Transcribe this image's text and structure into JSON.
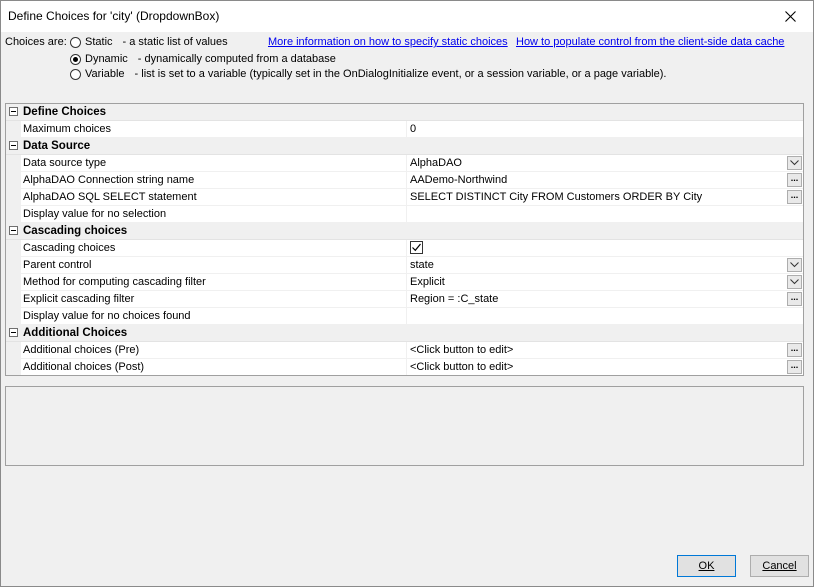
{
  "window": {
    "title": "Define Choices for 'city' (DropdownBox)"
  },
  "choices": {
    "label": "Choices are:",
    "options": [
      {
        "label": "Static",
        "desc": "- a static list of values",
        "checked": false
      },
      {
        "label": "Dynamic",
        "desc": "- dynamically computed from a database",
        "checked": true
      },
      {
        "label": "Variable",
        "desc": "- list is set to a variable (typically set in the OnDialogInitialize event, or a session variable, or a page variable).",
        "checked": false
      }
    ],
    "link_static": "More information on how to specify static choices",
    "link_cache": "How to populate control from the client-side data cache"
  },
  "grid": {
    "sections": [
      {
        "label": "Define Choices",
        "rows": [
          {
            "name": "Maximum choices",
            "value": "0"
          }
        ]
      },
      {
        "label": "Data Source",
        "rows": [
          {
            "name": "Data source type",
            "value": "AlphaDAO"
          },
          {
            "name": "AlphaDAO Connection string name",
            "value": "AADemo-Northwind"
          },
          {
            "name": "AlphaDAO SQL SELECT statement",
            "value": "SELECT DISTINCT City FROM Customers ORDER BY City"
          },
          {
            "name": "Display value for no selection",
            "value": ""
          }
        ]
      },
      {
        "label": "Cascading choices",
        "rows": [
          {
            "name": "Cascading choices",
            "value": "",
            "checked": true
          },
          {
            "name": "Parent control",
            "value": "state"
          },
          {
            "name": "Method for computing cascading filter",
            "value": "Explicit"
          },
          {
            "name": "Explicit cascading filter",
            "value": "Region = :C_state"
          },
          {
            "name": "Display value for no choices found",
            "value": ""
          }
        ]
      },
      {
        "label": "Additional Choices",
        "rows": [
          {
            "name": "Additional choices (Pre)",
            "value": "<Click button to edit>"
          },
          {
            "name": "Additional choices (Post)",
            "value": "<Click button to edit>"
          }
        ]
      }
    ],
    "ellipsis": "..."
  },
  "footer": {
    "ok_label": "OK",
    "cancel_label": "Cancel"
  }
}
